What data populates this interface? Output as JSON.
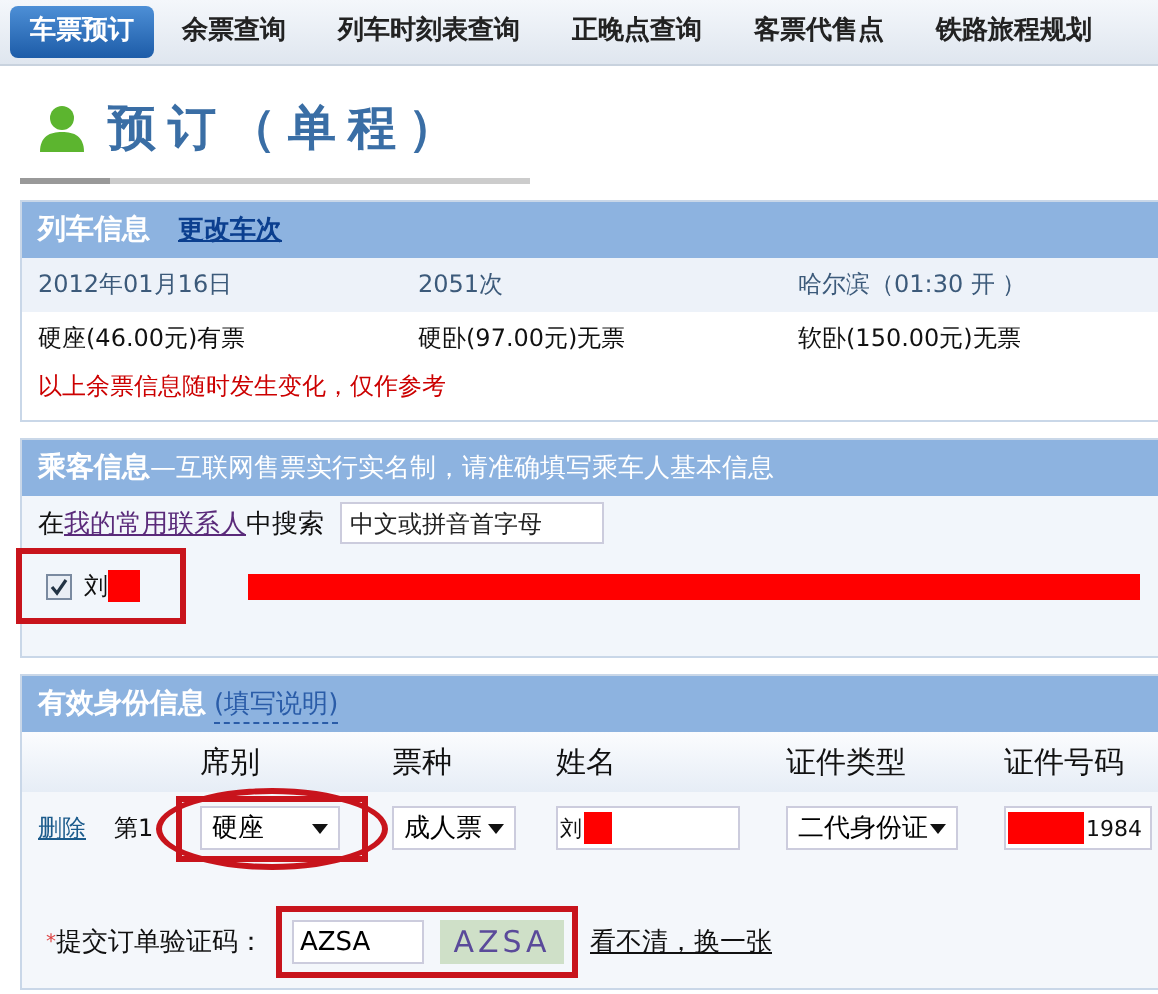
{
  "nav_tabs": [
    {
      "label": "车票预订",
      "selected": true
    },
    {
      "label": "余票查询",
      "selected": false
    },
    {
      "label": "列车时刻表查询",
      "selected": false
    },
    {
      "label": "正晚点查询",
      "selected": false
    },
    {
      "label": "客票代售点",
      "selected": false
    },
    {
      "label": "铁路旅程规划",
      "selected": false
    }
  ],
  "page_title": "预订（单程）",
  "train_info": {
    "title": "列车信息",
    "change_link": "更改车次",
    "date": "2012年01月16日",
    "train_no": "2051次",
    "departure": "哈尔滨（01:30 开 ）",
    "seats": [
      "硬座(46.00元)有票",
      "硬卧(97.00元)无票",
      "软卧(150.00元)无票"
    ],
    "notice": "以上余票信息随时发生变化，仅作参考"
  },
  "passenger_info": {
    "title": "乘客信息",
    "subtitle": "—互联网售票实行实名制，请准确填写乘车人基本信息",
    "search_prefix": "在",
    "search_link": "我的常用联系人",
    "search_suffix": "中搜索",
    "search_placeholder": "中文或拼音首字母",
    "contacts": [
      {
        "name": "刘",
        "checked": true
      }
    ]
  },
  "id_info": {
    "title": "有效身份信息",
    "help_link": "(填写说明)",
    "columns": [
      "席别",
      "票种",
      "姓名",
      "证件类型",
      "证件号码"
    ],
    "rows": [
      {
        "delete": "删除",
        "index": "第1",
        "seat": "硬座",
        "ticket_type": "成人票",
        "name": "刘",
        "id_type": "二代身份证",
        "id_number": "1984"
      }
    ],
    "captcha_label": "提交订单验证码：",
    "required_mark": "*",
    "captcha_value": "AZSA",
    "captcha_image": "AZSA",
    "refresh_link": "看不清，换一张"
  }
}
